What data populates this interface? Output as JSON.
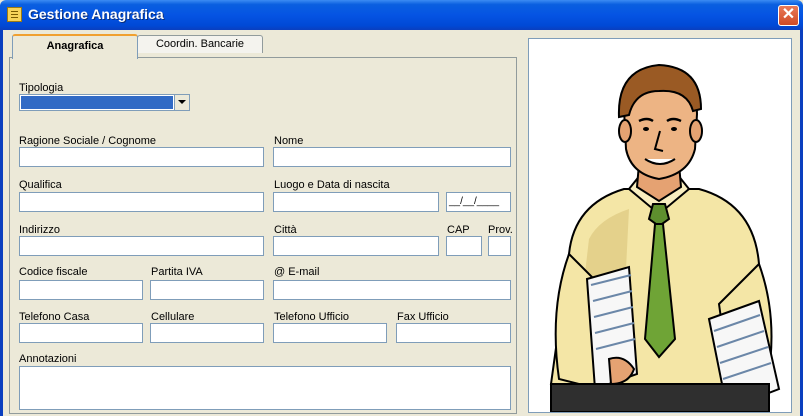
{
  "window": {
    "title": "Gestione Anagrafica",
    "close_glyph": "✕",
    "icon": "app-icon"
  },
  "tabs": [
    {
      "label": "Anagrafica",
      "active": true
    },
    {
      "label": "Coordin. Bancarie",
      "active": false
    }
  ],
  "form": {
    "tipologia": {
      "label": "Tipologia",
      "value": ""
    },
    "ragione_sociale": {
      "label": "Ragione Sociale  /  Cognome",
      "value": ""
    },
    "nome": {
      "label": "Nome",
      "value": ""
    },
    "qualifica": {
      "label": "Qualifica",
      "value": ""
    },
    "luogo_data_nascita": {
      "label": "Luogo e Data di nascita",
      "value": "",
      "date_value": "__/__/____"
    },
    "indirizzo": {
      "label": "Indirizzo",
      "value": ""
    },
    "citta": {
      "label": "Città",
      "value": ""
    },
    "cap": {
      "label": "CAP",
      "value": ""
    },
    "prov": {
      "label": "Prov.",
      "value": ""
    },
    "codice_fiscale": {
      "label": "Codice fiscale",
      "value": ""
    },
    "partita_iva": {
      "label": "Partita IVA",
      "value": ""
    },
    "email": {
      "label": "@ E-mail",
      "value": ""
    },
    "telefono_casa": {
      "label": "Telefono Casa",
      "value": ""
    },
    "cellulare": {
      "label": "Cellulare",
      "value": ""
    },
    "telefono_ufficio": {
      "label": "Telefono Ufficio",
      "value": ""
    },
    "fax_ufficio": {
      "label": "Fax Ufficio",
      "value": ""
    },
    "annotazioni": {
      "label": "Annotazioni",
      "value": ""
    }
  },
  "colors": {
    "title_bar": "#0554E3",
    "dialog_bg": "#ECE9D8",
    "field_border": "#7F9DB9",
    "selection": "#316AC5",
    "close_button": "#D04A25"
  },
  "illustration": {
    "icon": "businessman-clipart"
  }
}
